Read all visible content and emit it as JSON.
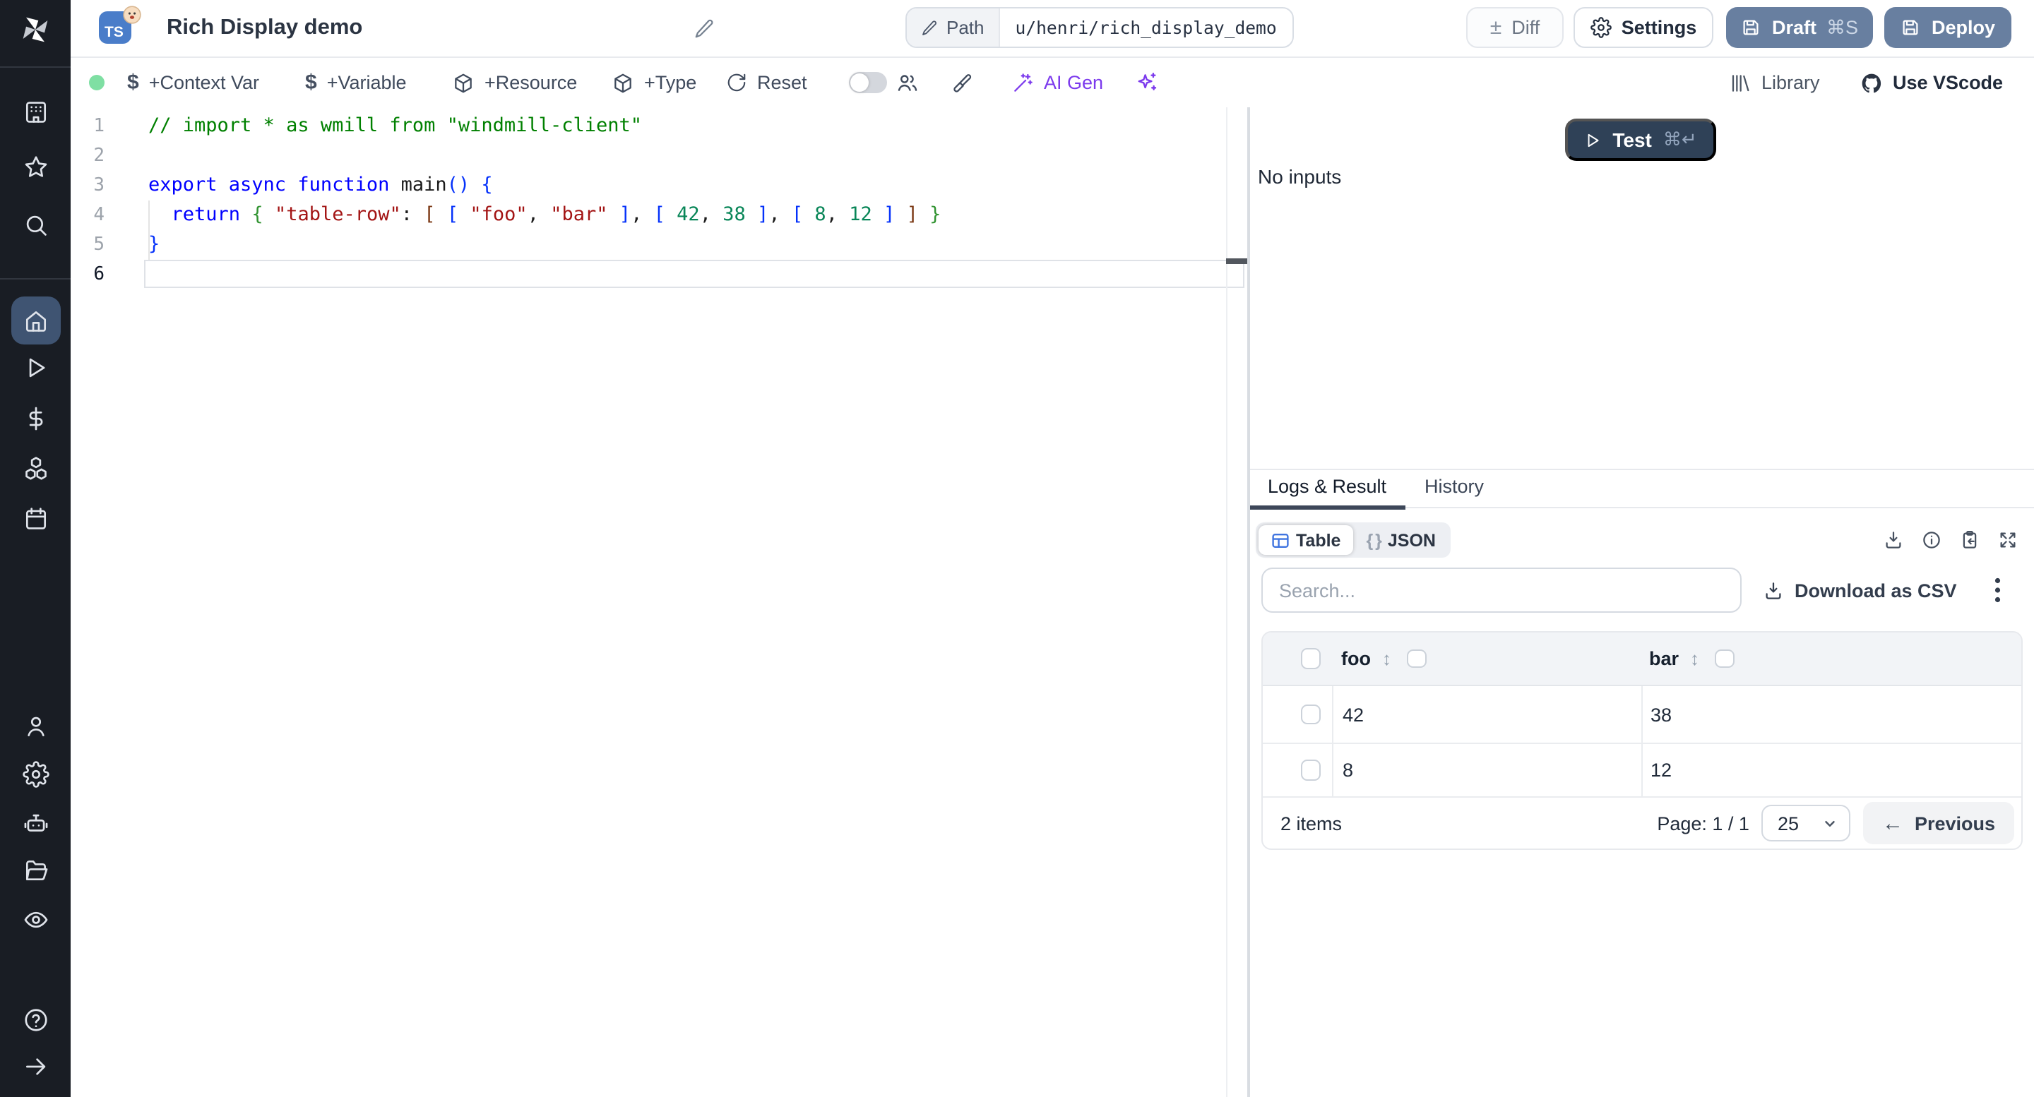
{
  "colors": {
    "accent_ai": "#7c3aed",
    "brand_button": "#687fa0",
    "test_button": "#2f4157",
    "status_green": "#7fdfa3",
    "table_icon_blue": "#3f74e0",
    "sidebar_bg": "#191d24",
    "sidebar_active_bg": "#3f5472",
    "ts_badge_blue": "#4a7dc9"
  },
  "sidebar": {
    "items": [
      "windmill-logo",
      "workspace",
      "favorites",
      "search",
      "home",
      "runs",
      "variables",
      "resources",
      "schedules",
      "users",
      "settings",
      "workers",
      "folders",
      "audit-logs",
      "help",
      "expand"
    ]
  },
  "header": {
    "badge": "TS",
    "title": "Rich Display demo",
    "path_label": "Path",
    "path_value": "u/henri/rich_display_demo",
    "diff_label": "Diff",
    "diff_icon": "±",
    "settings_label": "Settings",
    "draft_label": "Draft",
    "draft_shortcut": "⌘S",
    "deploy_label": "Deploy"
  },
  "toolbar": {
    "context_var": "+Context Var",
    "variable": "+Variable",
    "resource": "+Resource",
    "type": "+Type",
    "reset": "Reset",
    "ai_gen": "AI Gen",
    "library": "Library",
    "use_vscode": "Use VScode",
    "dollar": "$"
  },
  "editor": {
    "active_line": 6,
    "lines": [
      [
        [
          "cm",
          "// import * as wmill from \"windmill-client\""
        ]
      ],
      [],
      [
        [
          "kw",
          "export async function "
        ],
        [
          "pl",
          "main"
        ],
        [
          "b1",
          "() {"
        ]
      ],
      [
        [
          "pl",
          "  "
        ],
        [
          "kw",
          "return"
        ],
        [
          "pl",
          " "
        ],
        [
          "b2",
          "{"
        ],
        [
          "pl",
          " "
        ],
        [
          "str",
          "\"table-row\""
        ],
        [
          "pl",
          ": "
        ],
        [
          "b3",
          "["
        ],
        [
          "pl",
          " "
        ],
        [
          "b1",
          "["
        ],
        [
          "pl",
          " "
        ],
        [
          "str",
          "\"foo\""
        ],
        [
          "pl",
          ", "
        ],
        [
          "str",
          "\"bar\""
        ],
        [
          "pl",
          " "
        ],
        [
          "b1",
          "]"
        ],
        [
          "pl",
          ", "
        ],
        [
          "b1",
          "["
        ],
        [
          "pl",
          " "
        ],
        [
          "num",
          "42"
        ],
        [
          "pl",
          ", "
        ],
        [
          "num",
          "38"
        ],
        [
          "pl",
          " "
        ],
        [
          "b1",
          "]"
        ],
        [
          "pl",
          ", "
        ],
        [
          "b1",
          "["
        ],
        [
          "pl",
          " "
        ],
        [
          "num",
          "8"
        ],
        [
          "pl",
          ", "
        ],
        [
          "num",
          "12"
        ],
        [
          "pl",
          " "
        ],
        [
          "b1",
          "]"
        ],
        [
          "pl",
          " "
        ],
        [
          "b3",
          "]"
        ],
        [
          "pl",
          " "
        ],
        [
          "b2",
          "}"
        ]
      ],
      [
        [
          "b1",
          "}"
        ]
      ],
      []
    ]
  },
  "run_panel": {
    "test_label": "Test",
    "test_shortcut": "⌘↵",
    "no_inputs": "No inputs"
  },
  "result_panel": {
    "tab_logs": "Logs & Result",
    "tab_history": "History",
    "view_table": "Table",
    "view_json": "JSON",
    "braces_icon": "{ }"
  },
  "result_table": {
    "search_placeholder": "Search...",
    "download_csv": "Download as CSV",
    "columns": [
      "foo",
      "bar"
    ],
    "rows": [
      [
        "42",
        "38"
      ],
      [
        "8",
        "12"
      ]
    ],
    "items_label": "2 items",
    "page_label": "Page: 1 / 1",
    "page_size": "25",
    "previous_label": "Previous",
    "previous_arrow": "←",
    "sort_icon": "↕"
  }
}
